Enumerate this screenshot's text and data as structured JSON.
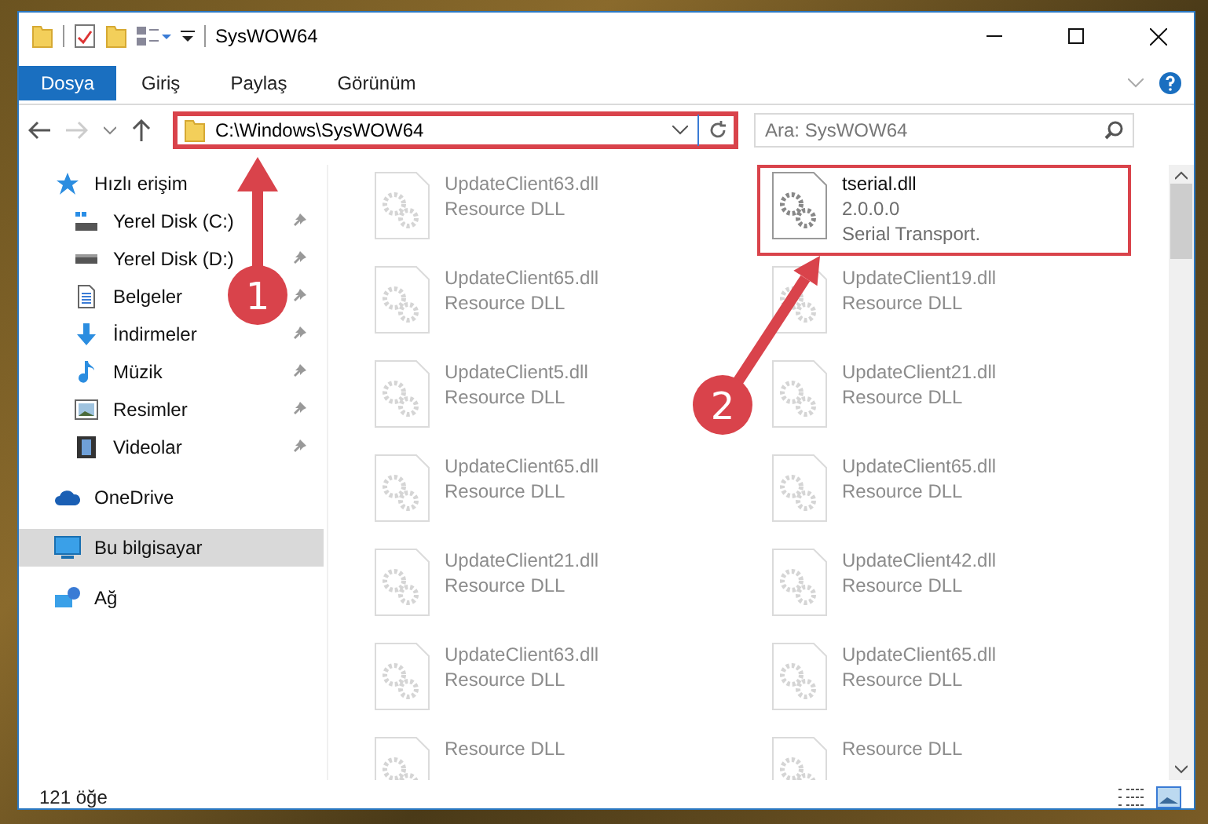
{
  "window": {
    "title": "SysWOW64"
  },
  "ribbon_tabs": [
    {
      "label": "Dosya",
      "kind": "file",
      "selected": false
    },
    {
      "label": "Giriş",
      "kind": "tab",
      "selected": false
    },
    {
      "label": "Paylaş",
      "kind": "tab",
      "selected": false
    },
    {
      "label": "Görünüm",
      "kind": "tab",
      "selected": false
    }
  ],
  "address_bar": {
    "path": "C:\\Windows\\SysWOW64",
    "highlighted": true
  },
  "search": {
    "placeholder": "Ara: SysWOW64"
  },
  "navigation": [
    {
      "label": "Hızlı erişim",
      "selected": false,
      "children": [
        {
          "label": "Yerel Disk (C:)",
          "pinned": true,
          "selected": false
        },
        {
          "label": "Yerel Disk (D:)",
          "pinned": true,
          "selected": false
        },
        {
          "label": "Belgeler",
          "pinned": true,
          "selected": false
        },
        {
          "label": "İndirmeler",
          "pinned": true,
          "selected": false
        },
        {
          "label": "Müzik",
          "pinned": true,
          "selected": false
        },
        {
          "label": "Resimler",
          "pinned": true,
          "selected": false
        },
        {
          "label": "Videolar",
          "pinned": true,
          "selected": false
        }
      ]
    },
    {
      "label": "OneDrive",
      "selected": false
    },
    {
      "label": "Bu bilgisayar",
      "selected": true
    },
    {
      "label": "Ağ",
      "selected": false
    }
  ],
  "files": [
    {
      "name": "UpdateClient63.dll",
      "type": "Resource DLL",
      "blurred": true,
      "highlighted": false
    },
    {
      "name": "tserial.dll",
      "version": "2.0.0.0",
      "type": "Serial Transport.",
      "blurred": false,
      "highlighted": true
    },
    {
      "name": "UpdateClient65.dll",
      "type": "Resource DLL",
      "blurred": true,
      "highlighted": false
    },
    {
      "name": "UpdateClient19.dll",
      "type": "Resource DLL",
      "blurred": true,
      "highlighted": false
    },
    {
      "name": "UpdateClient5.dll",
      "type": "Resource DLL",
      "blurred": true,
      "highlighted": false
    },
    {
      "name": "UpdateClient21.dll",
      "type": "Resource DLL",
      "blurred": true,
      "highlighted": false
    },
    {
      "name": "UpdateClient65.dll",
      "type": "Resource DLL",
      "blurred": true,
      "highlighted": false
    },
    {
      "name": "UpdateClient65.dll",
      "type": "Resource DLL",
      "blurred": true,
      "highlighted": false
    },
    {
      "name": "UpdateClient21.dll",
      "type": "Resource DLL",
      "blurred": true,
      "highlighted": false
    },
    {
      "name": "UpdateClient42.dll",
      "type": "Resource DLL",
      "blurred": true,
      "highlighted": false
    },
    {
      "name": "UpdateClient63.dll",
      "type": "Resource DLL",
      "blurred": true,
      "highlighted": false
    },
    {
      "name": "UpdateClient65.dll",
      "type": "Resource DLL",
      "blurred": true,
      "highlighted": false
    },
    {
      "type": "Resource DLL",
      "blurred": true,
      "highlighted": false
    },
    {
      "type": "Resource DLL",
      "blurred": true,
      "highlighted": false
    }
  ],
  "status_bar": {
    "item_count": "121 öğe"
  },
  "annotations": [
    {
      "label": "1"
    },
    {
      "label": "2"
    }
  ]
}
